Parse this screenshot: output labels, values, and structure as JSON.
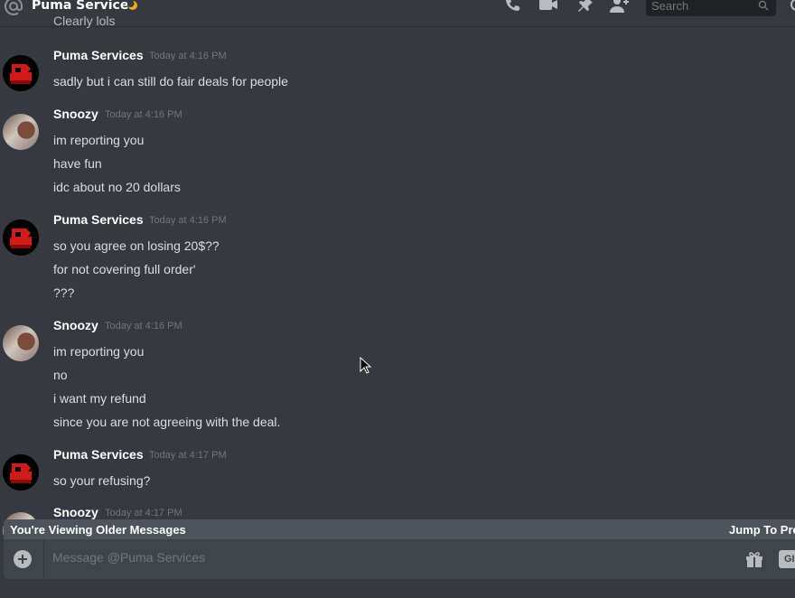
{
  "header": {
    "title": "Puma Services",
    "search_placeholder": "Search",
    "icons": [
      "at-icon",
      "moon-icon",
      "phone-icon",
      "video-icon",
      "pin-icon",
      "add-member-icon",
      "search-icon",
      "inbox-icon"
    ]
  },
  "partial_top_text": "Clearly lols",
  "messages": [
    {
      "author": "Puma Services",
      "time": "Today at 4:16 PM",
      "lines": [
        "sadly but i can still do fair deals for  people"
      ]
    },
    {
      "author": "Snoozy",
      "time": "Today at 4:16 PM",
      "lines": [
        "im reporting you",
        "have fun",
        "idc about no 20 dollars"
      ]
    },
    {
      "author": "Puma Services",
      "time": "Today at 4:16 PM",
      "lines": [
        "so you agree on losing 20$??",
        "for not covering full order'",
        "???"
      ]
    },
    {
      "author": "Snoozy",
      "time": "Today at 4:16 PM",
      "lines": [
        "im reporting you",
        "no",
        "i want my refund",
        "since you are not agreeing with the deal."
      ]
    },
    {
      "author": "Puma Services",
      "time": "Today at 4:17 PM",
      "lines": [
        "so your refusing?"
      ]
    },
    {
      "author": "Snoozy",
      "time": "Today at 4:17 PM",
      "lines": []
    }
  ],
  "older_bar": {
    "text": "You're Viewing Older Messages",
    "jump": "Jump To Present"
  },
  "composer": {
    "placeholder": "Message @Puma Services",
    "gif_label": "GIF"
  },
  "colors": {
    "background": "#36393f",
    "username": "#ffffff",
    "timestamp": "#72767d",
    "text": "#dcddde"
  }
}
